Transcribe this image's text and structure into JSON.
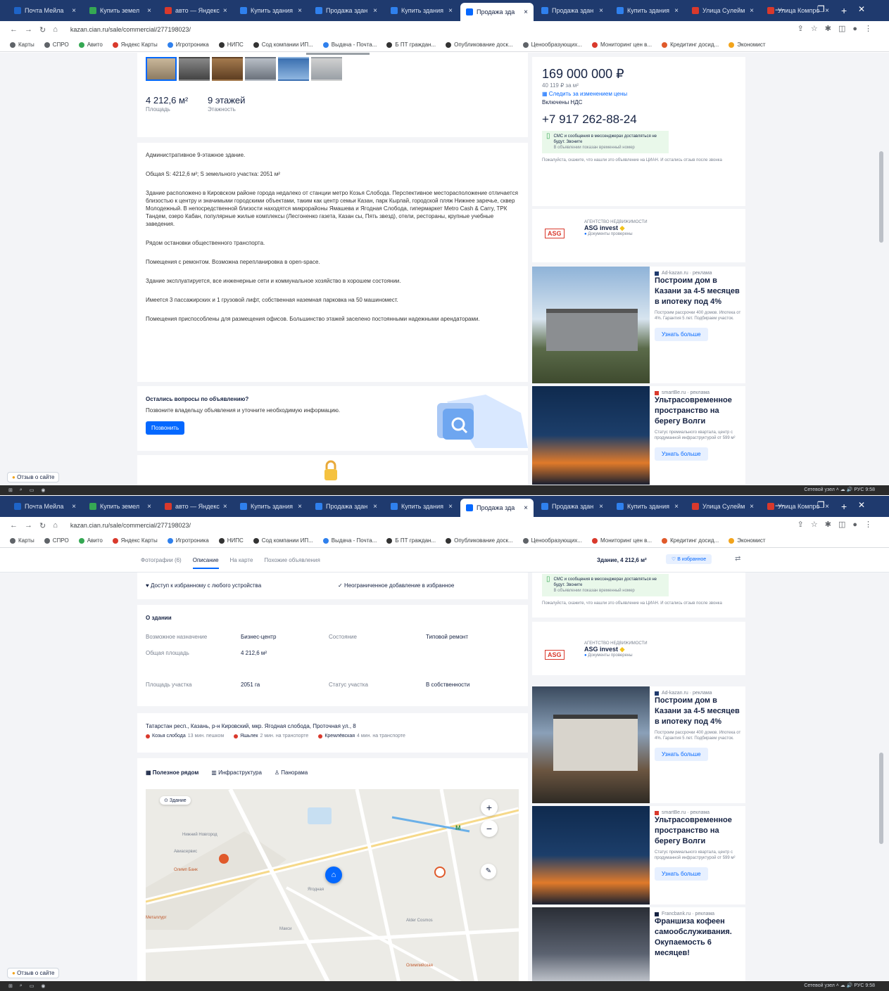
{
  "tabs": [
    {
      "label": "Почта Мейла",
      "active": false,
      "color": "#1e64c8"
    },
    {
      "label": "Купить земел",
      "active": false,
      "color": "#35a853"
    },
    {
      "label": "авто — Яндекс",
      "active": false,
      "color": "#d9392c"
    },
    {
      "label": "Купить здания",
      "active": false,
      "color": "#2f80ed"
    },
    {
      "label": "Продажа здан",
      "active": false,
      "color": "#2f80ed"
    },
    {
      "label": "Купить здания",
      "active": false,
      "color": "#2f80ed"
    },
    {
      "label": "Продажа зда",
      "active": true,
      "color": "#0468ff"
    },
    {
      "label": "Продажа здан",
      "active": false,
      "color": "#2f80ed"
    },
    {
      "label": "Купить здания",
      "active": false,
      "color": "#2f80ed"
    },
    {
      "label": "Улица Сулейм",
      "active": false,
      "color": "#d9392c"
    },
    {
      "label": "Улица Компро",
      "active": false,
      "color": "#d9392c"
    }
  ],
  "browser": {
    "url": "kazan.cian.ru/sale/commercial/277198023/",
    "window_controls": "— ❐ ✕"
  },
  "bookmarks": [
    {
      "label": "Карты",
      "color": "#5f6368"
    },
    {
      "label": "СПРО",
      "color": "#5f6368"
    },
    {
      "label": "Авито",
      "color": "#35a853"
    },
    {
      "label": "Яндекс Карты",
      "color": "#d9392c"
    },
    {
      "label": "Игротроника",
      "color": "#2f80ed"
    },
    {
      "label": "НИПС",
      "color": "#333333"
    },
    {
      "label": "Сод компании ИП...",
      "color": "#333333"
    },
    {
      "label": "Выдача - Почта...",
      "color": "#2f80ed"
    },
    {
      "label": "Б ПТ граждан...",
      "color": "#333333"
    },
    {
      "label": "Опубликование доск...",
      "color": "#333333"
    },
    {
      "label": "Ценообразующих...",
      "color": "#5f6368"
    },
    {
      "label": "Мониторинг цен в...",
      "color": "#d9392c"
    },
    {
      "label": "Кредитинг досид...",
      "color": "#e05a2b"
    },
    {
      "label": "Экономист",
      "color": "#f2a41c"
    }
  ],
  "listing": {
    "area_value": "4 212,6 м²",
    "area_label": "Площадь",
    "floors_value": "9 этажей",
    "floors_label": "Этажность",
    "description": [
      "Административное 9-этажное здание.",
      "Общая S: 4212,6 м²; S земельного участка: 2051 м²",
      "Здание расположено в Кировском районе города недалеко от станции метро Козья Слобода. Перспективное месторасположение отличается близостью к центру и значимыми городскими объектами, таким как центр семьи Казан, парк Кырлай, городской пляж Нижнее заречье, сквер Молодежный. В непосредственной близости находятся микрорайоны Ямашева и Ягодная Слобода, гипермаркет Metro Cash & Carry, ТРК Тандем, озеро Кабан, популярные жилые комплексы (Лесгоненко газета, Казан сы, Пять звезд), отели, рестораны, крупные учебные заведения.",
      "Рядом остановки общественного транспорта.",
      "Помещения с ремонтом. Возможна перепланировка в open-space.",
      "Здание эксплуатируется, все инженерные сети и коммунальное хозяйство в хорошем состоянии.",
      "Имеется 3 пассажирских и 1 грузовой лифт, собственная наземная парковка на 50 машиномест.",
      "Помещения приспособлены для размещения офисов. Большинство этажей заселено постоянными надежными арендаторами."
    ],
    "questions_title": "Остались вопросы по объявлению?",
    "questions_text": "Позвоните владельцу объявления и уточните необходимую информацию.",
    "call_button": "Позвонить"
  },
  "price_panel": {
    "price": "169 000 000 ₽",
    "per_m2": "40 119 ₽ за м²",
    "price_change_link": "Следить за изменением цены",
    "vat": "Включены НДС",
    "phone": "+7 917 262-88-24",
    "sms_title": "СМС и сообщения в мессенджерах доставляться не будут. Звоните",
    "sms_note": "В объявлении показан временный номер",
    "notice": "Пожалуйста, скажите, что нашли это объявление на ЦИАН. И остались отзыв после звонка",
    "agency_type": "АГЕНТСТВО НЕДВИЖИМОСТИ",
    "agency_name": "ASG invest",
    "agency_verified": "Документы проверены",
    "agency_logo": "ASG"
  },
  "ads": [
    {
      "source": "Ad-kazan.ru · реклама",
      "title": "Построим дом в Казани за 4-5 месяцев в ипотеку под 4%",
      "text": "Построим рассрочки 400 домов. Ипотека от 4%. Гарантия 5 лет. Подбираем участок.",
      "button": "Узнать больше"
    },
    {
      "source": "smartBe.ru · реклама",
      "title": "Ультрасовременное пространство на берегу Волги",
      "text": "Статус премиального квартала, центр с продуманной инфраструктурой от 599 м²",
      "button": "Узнать больше"
    },
    {
      "source": "Francbank.ru · реклама",
      "title": "Франшиза кофеен самообслуживания. Окупаемость 6 месяцев!",
      "text": "",
      "button": ""
    }
  ],
  "sticky_nav": {
    "items": [
      "Фотографии (6)",
      "Описание",
      "На карте",
      "Похожие объявления"
    ],
    "active": "Описание",
    "building_area": "Здание, 4 212,6 м²",
    "favorite_button": "♡ В избранное",
    "share_icon": "share-icon"
  },
  "favorites_promo": {
    "left": "Доступ к избранному с любого устройства",
    "right": "Неограниченное добавление в избранное"
  },
  "building_info": {
    "title": "О здании",
    "rows": [
      {
        "label": "Возможное назначение",
        "value": "Бизнес-центр",
        "label2": "Состояние",
        "value2": "Типовой ремонт"
      },
      {
        "label": "Общая площадь",
        "value": "4 212,6 м²",
        "label2": "",
        "value2": ""
      },
      {
        "label": "Площадь участка",
        "value": "2051 га",
        "label2": "Статус участка",
        "value2": "В собственности"
      }
    ]
  },
  "address": {
    "line": "Татарстан респ., Казань, р-н Кировский, мкр. Ягодная слобода, Проточная ул., 8",
    "metro": [
      {
        "name": "Козья слобода",
        "time": "13 мин. пешком",
        "color": "#d9392c"
      },
      {
        "name": "Яшьлек",
        "time": "2 мин. на транспорте",
        "color": "#d9392c"
      },
      {
        "name": "Кремлёвская",
        "time": "4 мин. на транспорте",
        "color": "#d9392c"
      }
    ]
  },
  "map": {
    "tabs": [
      "Полезное рядом",
      "Инфраструктура",
      "Панорама"
    ],
    "building_chip": "Здание",
    "labels": [
      "Металлург",
      "Нижний Новгород",
      "Авиасервис",
      "Олимп Банк",
      "Ягодная",
      "Макси",
      "Alder Cosmos",
      "Олимпийская"
    ],
    "zoom_in": "+",
    "zoom_out": "−"
  },
  "feedback_label": "Отзыв о сайте",
  "taskbar_tray": "Сетевой узел ˄ ☁ 🔊 РУС 9:58"
}
